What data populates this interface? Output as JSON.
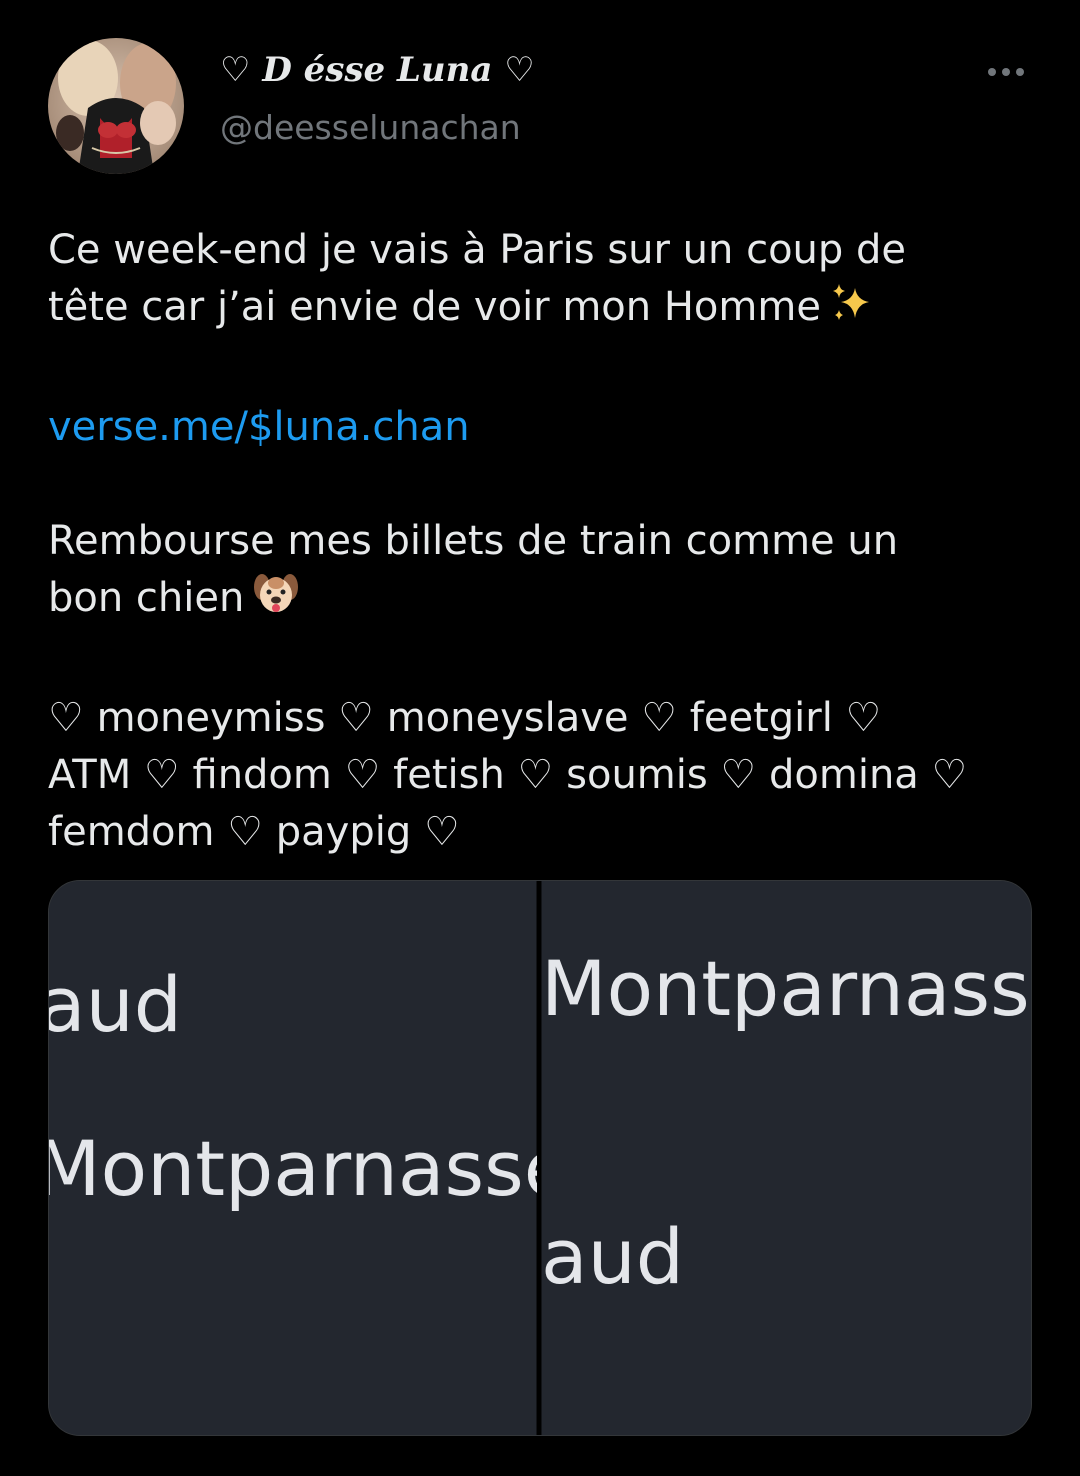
{
  "tweet": {
    "display_name": "♡ D  ésse Luna ♡",
    "handle": "@deesselunachan",
    "more_label": "•••",
    "text_line1": "Ce week-end je vais à Paris sur un coup de",
    "text_line2": "tête car j’ai envie de voir mon Homme",
    "link": "verse.me/$luna.chan",
    "text_line3": "Rembourse mes billets de train comme un",
    "text_line4": "bon chien",
    "tags_line1": "♡ moneymiss ♡ moneyslave ♡ feetgirl ♡",
    "tags_line2": "ATM ♡ findom ♡ fetish ♡ soumis ♡ domina ♡",
    "tags_line3": "femdom ♡ paypig ♡"
  },
  "media": {
    "left_top": "aud",
    "left_bottom": "Montparnasse",
    "right_top": "Montparnasse",
    "right_bottom": "aud"
  },
  "icons": {
    "sparkles": "sparkles-icon",
    "dog": "dog-face-icon",
    "more": "more-horizontal-icon"
  },
  "colors": {
    "background": "#000000",
    "text": "#e7e9ea",
    "secondary": "#71767b",
    "link": "#1d9bf0",
    "media_bg": "#23272f"
  }
}
